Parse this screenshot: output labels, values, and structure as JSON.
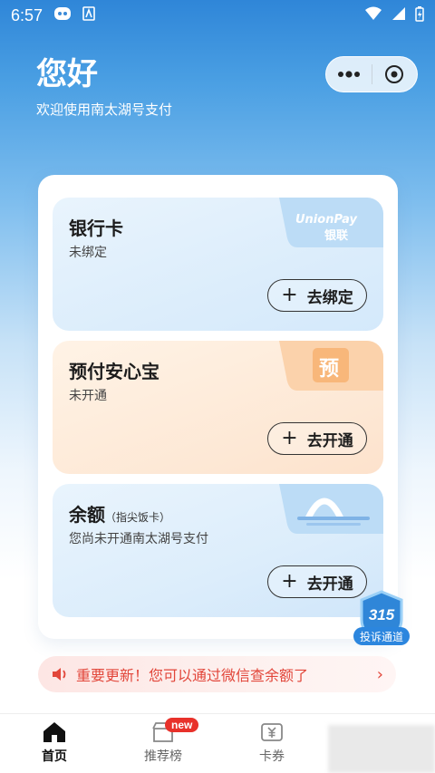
{
  "status_bar": {
    "time": "6:57"
  },
  "greeting": {
    "title": "您好",
    "subtitle": "欢迎使用南太湖号支付"
  },
  "cards": [
    {
      "title": "银行卡",
      "status": "未绑定",
      "button": "去绑定",
      "logo_text": "UnionPay",
      "logo_sub": "银联"
    },
    {
      "title": "预付安心宝",
      "status": "未开通",
      "button": "去开通",
      "logo_text": "预"
    },
    {
      "title": "余额",
      "title_note": "（指尖饭卡）",
      "status": "您尚未开通南太湖号支付",
      "button": "去开通"
    }
  ],
  "complaint_badge": {
    "number": "315",
    "label": "投诉通道"
  },
  "notice": {
    "text": "重要更新！您可以通过微信查余额了"
  },
  "tabbar": {
    "tabs": [
      {
        "label": "首页",
        "icon": "home-icon",
        "active": true
      },
      {
        "label": "推荐榜",
        "icon": "shop-icon",
        "badge": "new"
      },
      {
        "label": "卡券",
        "icon": "ticket-icon"
      }
    ]
  },
  "colors": {
    "accent": "#2f86d8",
    "notice": "#e2463a",
    "badge_new": "#e8312a"
  }
}
